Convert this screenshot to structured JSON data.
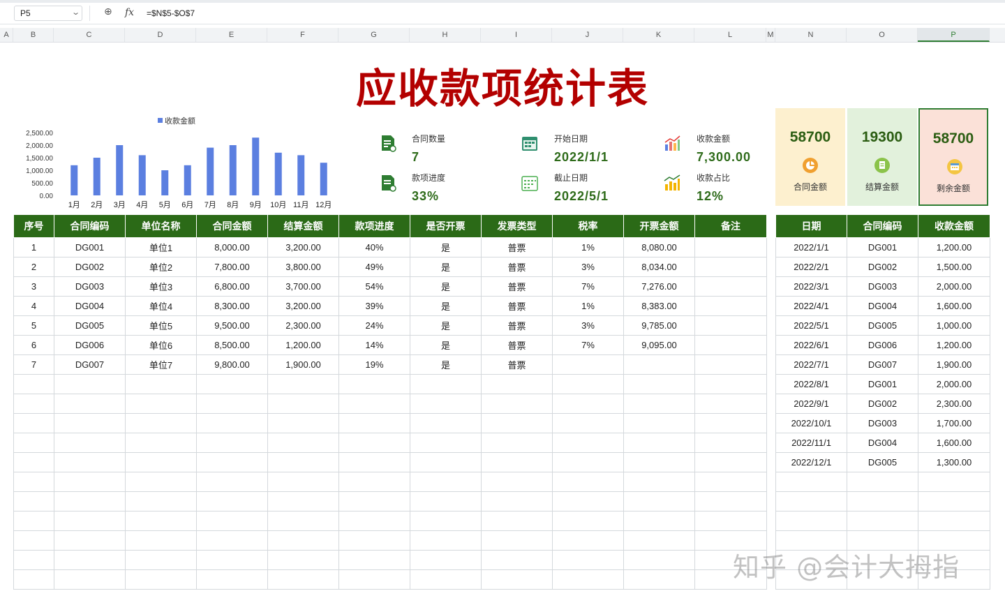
{
  "formula_bar": {
    "cell_ref": "P5",
    "formula": "=$N$5-$O$7"
  },
  "column_headers": [
    "A",
    "B",
    "C",
    "D",
    "E",
    "F",
    "G",
    "H",
    "I",
    "J",
    "K",
    "L",
    "M",
    "N",
    "O",
    "P"
  ],
  "title": "应收款项统计表",
  "kpi": {
    "contract_count_label": "合同数量",
    "contract_count": "7",
    "progress_label": "款项进度",
    "progress": "33%",
    "start_date_label": "开始日期",
    "start_date": "2022/1/1",
    "end_date_label": "截止日期",
    "end_date": "2022/5/1",
    "received_label": "收款金额",
    "received": "7,300.00",
    "ratio_label": "收款占比",
    "ratio": "12%"
  },
  "cards": [
    {
      "value": "58700",
      "label": "合同金额",
      "bg": "#fdf0cf",
      "icon_color": "#f0a030",
      "icon": "chart-coin-icon"
    },
    {
      "value": "19300",
      "label": "结算金额",
      "bg": "#e2f1dc",
      "icon_color": "#8bc34a",
      "icon": "document-icon"
    },
    {
      "value": "58700",
      "label": "剩余金额",
      "bg": "#fbe1d8",
      "icon_color": "#f4c542",
      "icon": "calendar-icon"
    }
  ],
  "chart_data": {
    "type": "bar",
    "legend": "收款金额",
    "categories": [
      "1月",
      "2月",
      "3月",
      "4月",
      "5月",
      "6月",
      "7月",
      "8月",
      "9月",
      "10月",
      "11月",
      "12月"
    ],
    "values": [
      1200,
      1500,
      2000,
      1600,
      1000,
      1200,
      1900,
      2000,
      2300,
      1700,
      1600,
      1300
    ],
    "ytick_labels": [
      "2,500.00",
      "2,000.00",
      "1,500.00",
      "1,000.00",
      "500.00",
      "0.00"
    ],
    "ylim": [
      0,
      2500
    ],
    "color": "#5b7fe0"
  },
  "main_table": {
    "headers": [
      "序号",
      "合同编码",
      "单位名称",
      "合同金额",
      "结算金额",
      "款项进度",
      "是否开票",
      "发票类型",
      "税率",
      "开票金额",
      "备注"
    ],
    "rows": [
      [
        "1",
        "DG001",
        "单位1",
        "8,000.00",
        "3,200.00",
        "40%",
        "是",
        "普票",
        "1%",
        "8,080.00",
        ""
      ],
      [
        "2",
        "DG002",
        "单位2",
        "7,800.00",
        "3,800.00",
        "49%",
        "是",
        "普票",
        "3%",
        "8,034.00",
        ""
      ],
      [
        "3",
        "DG003",
        "单位3",
        "6,800.00",
        "3,700.00",
        "54%",
        "是",
        "普票",
        "7%",
        "7,276.00",
        ""
      ],
      [
        "4",
        "DG004",
        "单位4",
        "8,300.00",
        "3,200.00",
        "39%",
        "是",
        "普票",
        "1%",
        "8,383.00",
        ""
      ],
      [
        "5",
        "DG005",
        "单位5",
        "9,500.00",
        "2,300.00",
        "24%",
        "是",
        "普票",
        "3%",
        "9,785.00",
        ""
      ],
      [
        "6",
        "DG006",
        "单位6",
        "8,500.00",
        "1,200.00",
        "14%",
        "是",
        "普票",
        "7%",
        "9,095.00",
        ""
      ],
      [
        "7",
        "DG007",
        "单位7",
        "9,800.00",
        "1,900.00",
        "19%",
        "是",
        "普票",
        "",
        "",
        " "
      ]
    ]
  },
  "side_table": {
    "headers": [
      "日期",
      "合同编码",
      "收款金额"
    ],
    "rows": [
      [
        "2022/1/1",
        "DG001",
        "1,200.00"
      ],
      [
        "2022/2/1",
        "DG002",
        "1,500.00"
      ],
      [
        "2022/3/1",
        "DG003",
        "2,000.00"
      ],
      [
        "2022/4/1",
        "DG004",
        "1,600.00"
      ],
      [
        "2022/5/1",
        "DG005",
        "1,000.00"
      ],
      [
        "2022/6/1",
        "DG006",
        "1,200.00"
      ],
      [
        "2022/7/1",
        "DG007",
        "1,900.00"
      ],
      [
        "2022/8/1",
        "DG001",
        "2,000.00"
      ],
      [
        "2022/9/1",
        "DG002",
        "2,300.00"
      ],
      [
        "2022/10/1",
        "DG003",
        "1,700.00"
      ],
      [
        "2022/11/1",
        "DG004",
        "1,600.00"
      ],
      [
        "2022/12/1",
        "DG005",
        "1,300.00"
      ]
    ]
  },
  "watermark": "知乎 @会计大拇指"
}
